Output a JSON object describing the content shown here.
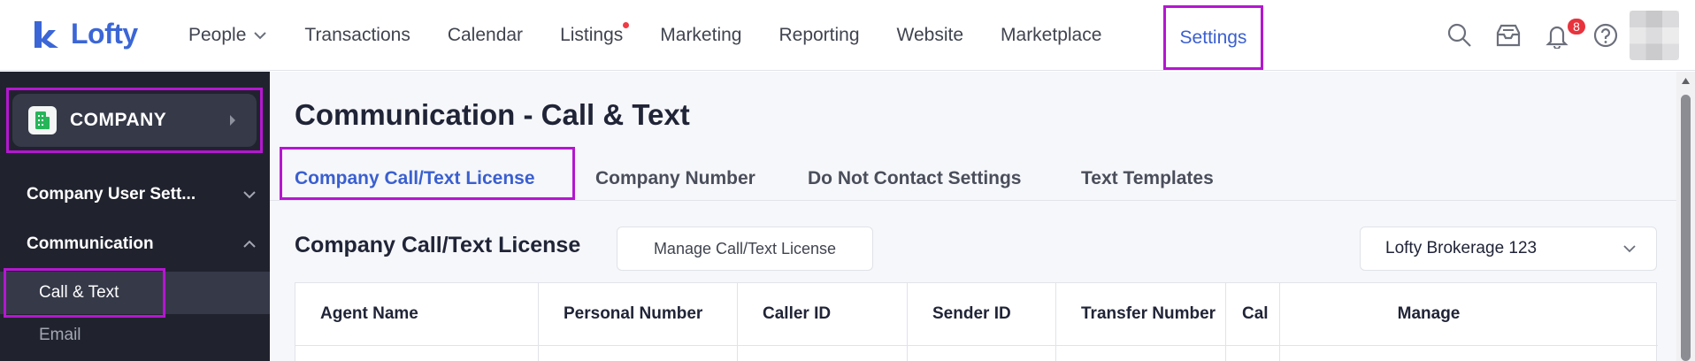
{
  "brand": {
    "name": "Lofty"
  },
  "nav": {
    "items": [
      {
        "label": "People"
      },
      {
        "label": "Transactions"
      },
      {
        "label": "Calendar"
      },
      {
        "label": "Listings"
      },
      {
        "label": "Marketing"
      },
      {
        "label": "Reporting"
      },
      {
        "label": "Website"
      },
      {
        "label": "Marketplace"
      },
      {
        "label": "Settings"
      }
    ],
    "notification_count": "8",
    "icons": [
      "search-icon",
      "inbox-icon",
      "bell-icon",
      "help-icon"
    ]
  },
  "sidebar": {
    "company": "COMPANY",
    "groups": [
      {
        "label": "Company User Sett...",
        "expanded": false
      },
      {
        "label": "Communication",
        "expanded": true
      }
    ],
    "subitems": [
      {
        "label": "Call & Text",
        "active": true
      },
      {
        "label": "Email",
        "active": false
      }
    ]
  },
  "main": {
    "title": "Communication - Call & Text",
    "tabs": [
      {
        "label": "Company Call/Text License",
        "active": true
      },
      {
        "label": "Company Number"
      },
      {
        "label": "Do Not Contact Settings"
      },
      {
        "label": "Text Templates"
      }
    ],
    "section_title": "Company Call/Text License",
    "manage_button": "Manage Call/Text License",
    "brokerage_select": "Lofty Brokerage 123",
    "table": {
      "columns": [
        "Agent Name",
        "Personal Number",
        "Caller ID",
        "Sender ID",
        "Transfer Number",
        "Cal",
        "Manage"
      ]
    }
  },
  "colors": {
    "accent": "#3a5fd0",
    "highlight_box": "#b417d0",
    "sidebar_bg": "#20232e",
    "badge": "#e8333d"
  }
}
